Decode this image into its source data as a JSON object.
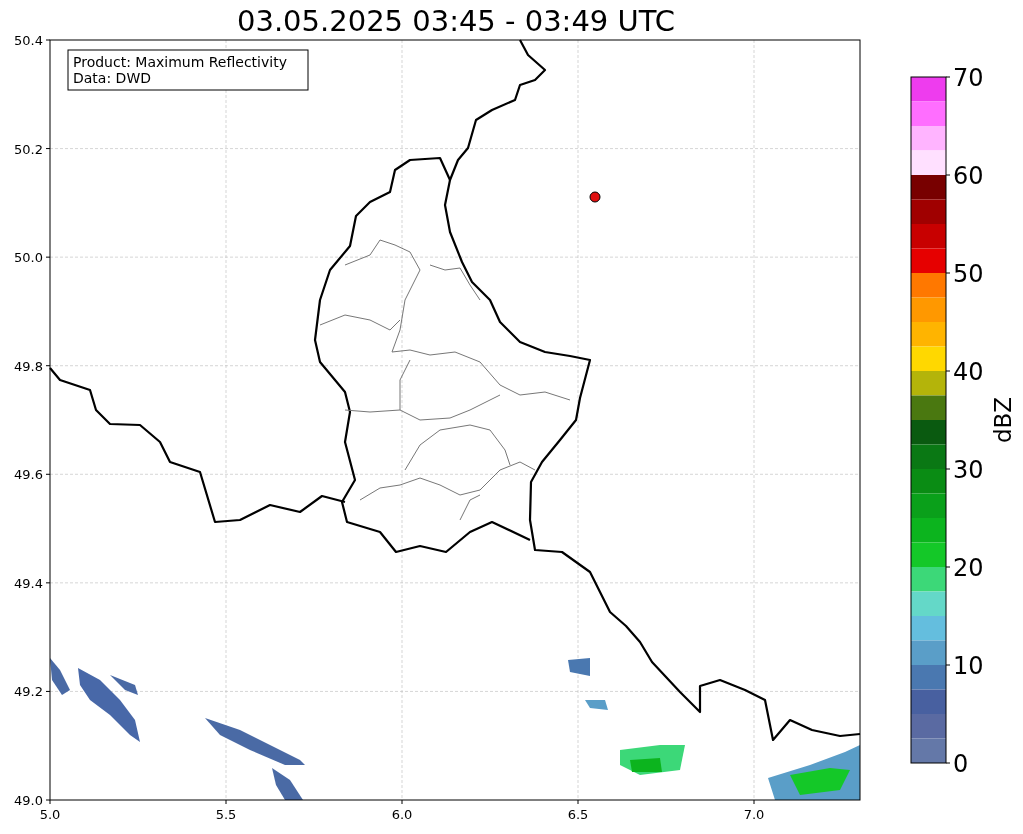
{
  "title": "03.05.2025 03:45 - 03:49 UTC",
  "info_box": [
    "Product: Maximum Reflectivity",
    "Data: DWD"
  ],
  "x_axis": {
    "ticks": [
      "5.0",
      "5.5",
      "6.0",
      "6.5",
      "7.0"
    ]
  },
  "y_axis": {
    "ticks": [
      "50.4",
      "50.2",
      "50.0",
      "49.8",
      "49.6",
      "49.4",
      "49.2",
      "49.0"
    ]
  },
  "colorbar": {
    "label": "dBZ",
    "ticks": [
      "70",
      "60",
      "50",
      "40",
      "30",
      "20",
      "10",
      "0"
    ],
    "segments": [
      {
        "color": "#ee3cee"
      },
      {
        "color": "#ff6eff"
      },
      {
        "color": "#ffb4ff"
      },
      {
        "color": "#ffe0ff"
      },
      {
        "color": "#780000"
      },
      {
        "color": "#a00000"
      },
      {
        "color": "#c80000"
      },
      {
        "color": "#e60000"
      },
      {
        "color": "#ff7800"
      },
      {
        "color": "#ff9800"
      },
      {
        "color": "#ffb400"
      },
      {
        "color": "#ffd800"
      },
      {
        "color": "#b4b40a"
      },
      {
        "color": "#4a7810"
      },
      {
        "color": "#0a5a10"
      },
      {
        "color": "#0a7814"
      },
      {
        "color": "#0a8c14"
      },
      {
        "color": "#0aa01a"
      },
      {
        "color": "#0cb41e"
      },
      {
        "color": "#14c828"
      },
      {
        "color": "#3cd878"
      },
      {
        "color": "#64d8c8"
      },
      {
        "color": "#64bede"
      },
      {
        "color": "#5a9ec8"
      },
      {
        "color": "#4a78b0"
      },
      {
        "color": "#4860a0"
      },
      {
        "color": "#5a6aa2"
      },
      {
        "color": "#6478a8"
      }
    ]
  }
}
